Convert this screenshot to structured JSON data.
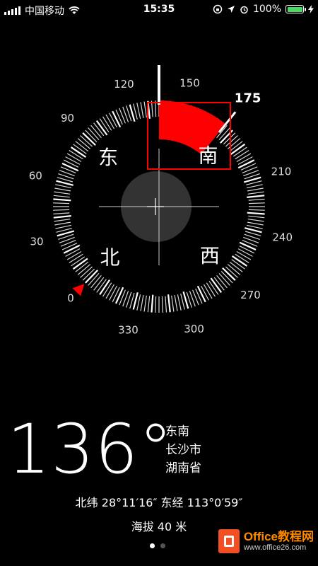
{
  "status_bar": {
    "carrier": "中国移动",
    "time": "15:35",
    "battery_percent": "100%",
    "battery_level": 1.0
  },
  "compass": {
    "heading": 136,
    "target_bearing": 175,
    "target_label": "175",
    "degree_labels": [
      "0",
      "30",
      "60",
      "90",
      "120",
      "150",
      "210",
      "240",
      "270",
      "300",
      "330"
    ],
    "cardinals": {
      "north": "北",
      "east": "东",
      "south": "南",
      "west": "西"
    },
    "colors": {
      "accent": "#ff0000",
      "ticks": "#ffffff",
      "center_disc": "#333333"
    }
  },
  "heading_display": {
    "degrees": "136°",
    "direction": "东南",
    "city": "长沙市",
    "province": "湖南省"
  },
  "location": {
    "coordinates": "北纬 28°11′16″  东经 113°0′59″",
    "altitude": "海拔 40 米"
  },
  "pager": {
    "pages": 2,
    "active": 0
  },
  "watermark": {
    "title": "Office教程网",
    "url": "www.office26.com"
  }
}
